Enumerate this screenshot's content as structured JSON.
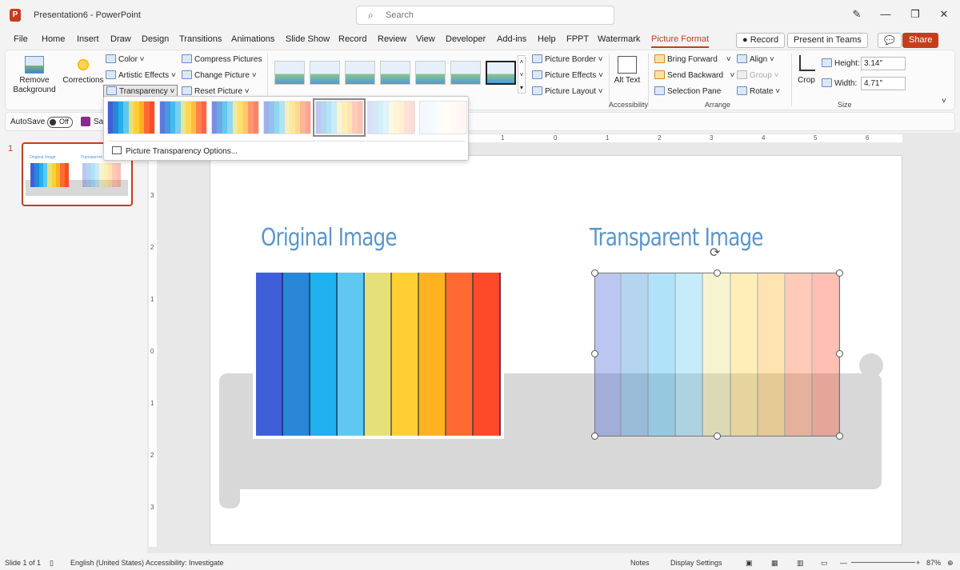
{
  "titlebar": {
    "app_icon": "P",
    "doc_title": "Presentation6  -  PowerPoint",
    "search_placeholder": "Search",
    "pen_icon": "✎",
    "minimize": "—",
    "maximize": "❐",
    "close": "✕"
  },
  "tabs": [
    "File",
    "Home",
    "Insert",
    "Draw",
    "Design",
    "Transitions",
    "Animations",
    "Slide Show",
    "Record",
    "Review",
    "View",
    "Developer",
    "Add-ins",
    "Help",
    "FPPT",
    "Watermark",
    "Picture Format"
  ],
  "top_buttons": {
    "record": "● Record",
    "teams": "Present in Teams",
    "comments": "💬",
    "share": "Share"
  },
  "ribbon": {
    "remove_background": "Remove Background",
    "corrections": "Corrections",
    "color": "Color",
    "artistic_effects": "Artistic Effects",
    "transparency": "Transparency",
    "compress_pictures": "Compress Pictures",
    "change_picture": "Change Picture",
    "reset_picture": "Reset Picture",
    "picture_border": "Picture Border",
    "picture_effects": "Picture Effects",
    "picture_layout": "Picture Layout",
    "alt_text": "Alt Text",
    "accessibility": "Accessibility",
    "bring_forward": "Bring Forward",
    "send_backward": "Send Backward",
    "selection_pane": "Selection Pane",
    "align": "Align",
    "group": "Group",
    "rotate": "Rotate",
    "arrange": "Arrange",
    "crop": "Crop",
    "height_label": "Height:",
    "height_value": "3.14\"",
    "width_label": "Width:",
    "width_value": "4.71\"",
    "size": "Size"
  },
  "autosave": {
    "label": "AutoSave",
    "state": "Off",
    "save": "Sav"
  },
  "dropdown": {
    "option": "Picture Transparency Options..."
  },
  "slide": {
    "number": "1",
    "left_heading": "Original Image",
    "right_heading": "Transparent Image",
    "thumb_left": "Original Image",
    "thumb_right": "Transparent Im..."
  },
  "ruler": {
    "h_ticks": [
      "1",
      "0",
      "1",
      "2",
      "3",
      "4",
      "5",
      "6"
    ],
    "v_ticks": [
      "3",
      "2",
      "1",
      "0",
      "1",
      "2",
      "3"
    ]
  },
  "statusbar": {
    "slide": "Slide 1 of 1",
    "language": "English (United States)",
    "accessibility": "Accessibility: Investigate",
    "notes": "Notes",
    "display_settings": "Display Settings",
    "zoom": "87%"
  },
  "colors": {
    "accent": "#c43e1c",
    "heading": "#5b95c9",
    "stripes": [
      "#3f5fd9",
      "#2a86d6",
      "#1fb0ef",
      "#5ec8f0",
      "#e6e07a",
      "#ffcf33",
      "#ffb21f",
      "#ff6a33",
      "#ff4a2a"
    ]
  }
}
